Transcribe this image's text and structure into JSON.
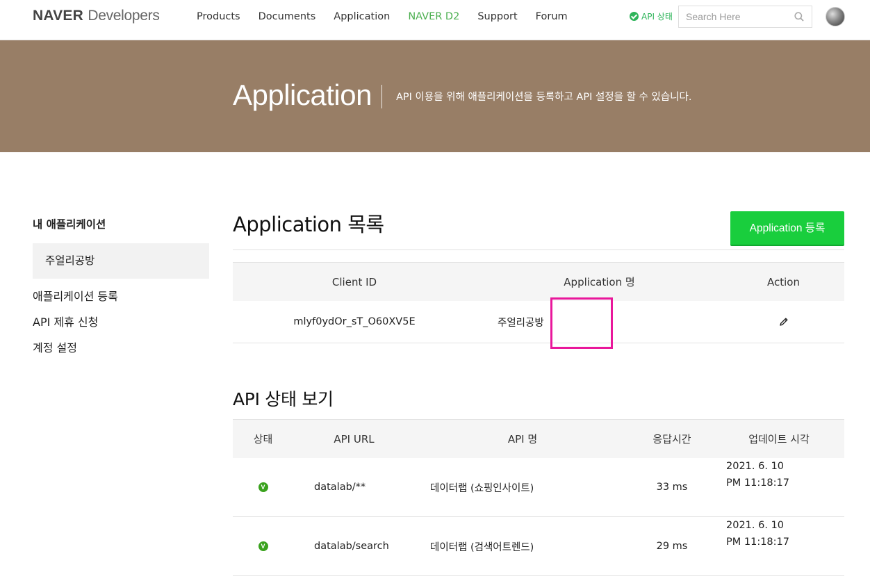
{
  "header": {
    "logo_brand": "NAVER",
    "logo_sub": "Developers",
    "nav": [
      {
        "label": "Products"
      },
      {
        "label": "Documents"
      },
      {
        "label": "Application"
      },
      {
        "label": "NAVER D2"
      },
      {
        "label": "Support"
      },
      {
        "label": "Forum"
      }
    ],
    "api_status_label": "API 상태",
    "search_placeholder": "Search Here",
    "colors": {
      "active_nav": "#4caf50",
      "status_green": "#2eb45a"
    }
  },
  "hero": {
    "title": "Application",
    "description": "API 이용을 위해 애플리케이션을 등록하고 API 설정을 할 수 있습니다.",
    "background": "#987e66"
  },
  "sidebar": {
    "title": "내 애플리케이션",
    "active_item": "주얼리공방",
    "links": [
      {
        "label": "애플리케이션 등록"
      },
      {
        "label": "API 제휴 신청"
      },
      {
        "label": "계정 설정"
      }
    ]
  },
  "app_list": {
    "title": "Application 목록",
    "register_button": "Application 등록",
    "columns": [
      "Client ID",
      "Application 명",
      "Action"
    ],
    "rows": [
      {
        "client_id": "mlyf0ydOr_sT_O60XV5E",
        "name": "주얼리공방",
        "action_icon": "pencil-icon"
      }
    ],
    "button_color": "#19ce3d"
  },
  "api_status": {
    "title": "API 상태 보기",
    "columns": [
      "상태",
      "API URL",
      "API 명",
      "응답시간",
      "업데이트 시각"
    ],
    "rows": [
      {
        "status": "V",
        "url": "datalab/**",
        "name": "데이터랩 (쇼핑인사이트)",
        "response": "33 ms",
        "date": "2021. 6. 10",
        "time": "PM 11:18:17"
      },
      {
        "status": "V",
        "url": "datalab/search",
        "name": "데이터랩 (검색어트렌드)",
        "response": "29 ms",
        "date": "2021. 6. 10",
        "time": "PM 11:18:17"
      }
    ]
  }
}
